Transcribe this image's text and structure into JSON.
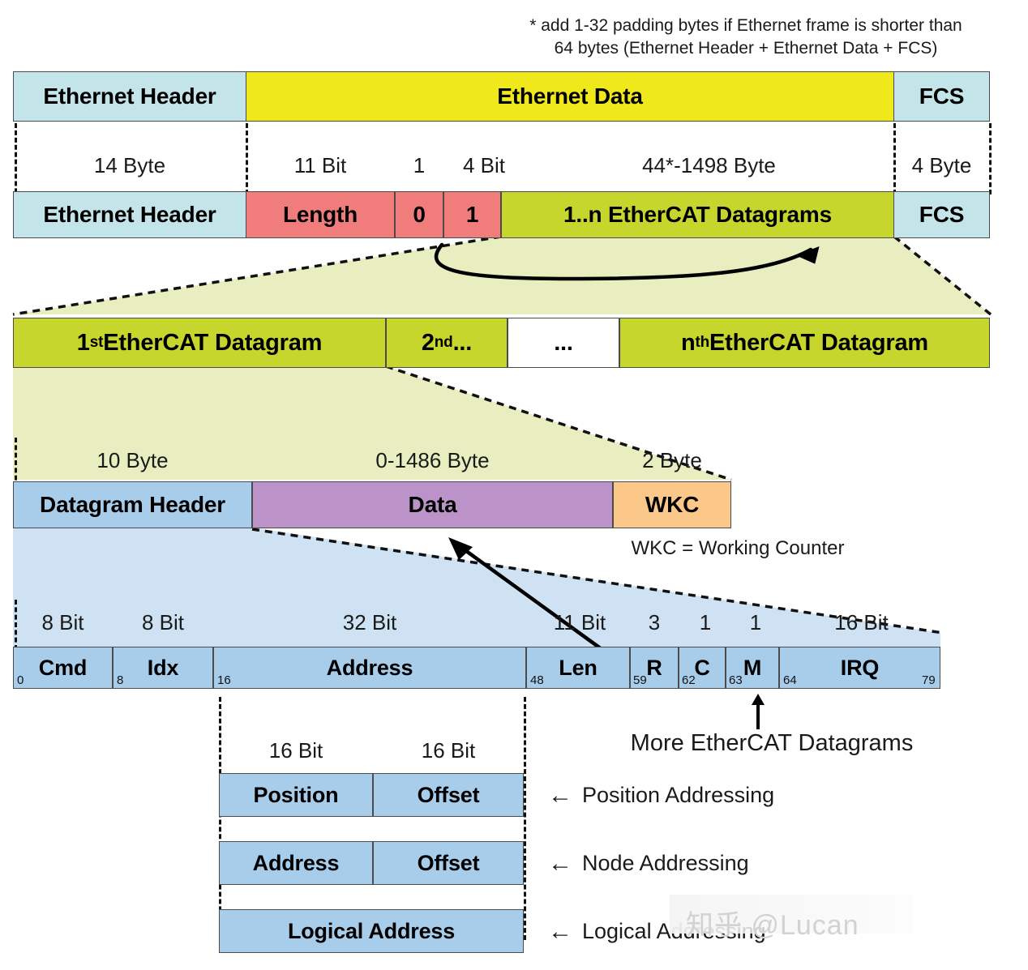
{
  "footnote": {
    "line1": "* add 1-32 padding bytes if Ethernet frame is shorter than",
    "line2": "64 bytes (Ethernet Header + Ethernet Data + FCS)"
  },
  "ethernet_frame": {
    "row_top": [
      {
        "label": "Ethernet Header",
        "color": "#c3e4e8"
      },
      {
        "label": "Ethernet Data",
        "color": "#efe81a"
      },
      {
        "label": "FCS",
        "color": "#c3e4e8"
      }
    ],
    "sizes": [
      "14 Byte",
      "11 Bit",
      "1",
      "4 Bit",
      "44*-1498 Byte",
      "4 Byte"
    ],
    "row_bottom": [
      {
        "label": "Ethernet Header",
        "color": "#c3e4e8"
      },
      {
        "label": "Length",
        "color": "#f07c7c"
      },
      {
        "label": "0",
        "color": "#f07c7c"
      },
      {
        "label": "1",
        "color": "#f07c7c"
      },
      {
        "label": "1..n EtherCAT Datagrams",
        "color": "#c6d62c"
      },
      {
        "label": "FCS",
        "color": "#c3e4e8"
      }
    ]
  },
  "datagram_list": [
    {
      "label": "1st EtherCAT Datagram",
      "sup": "st",
      "base": "1",
      "tail": " EtherCAT Datagram",
      "color": "#c6d62c"
    },
    {
      "label": "2nd...",
      "sup": "nd",
      "base": "2",
      "tail": "...",
      "color": "#c6d62c"
    },
    {
      "label": "...",
      "color": "#ffffff"
    },
    {
      "label": "nth EtherCAT Datagram",
      "sup": "th",
      "base": "n",
      "tail": " EtherCAT Datagram",
      "color": "#c6d62c"
    }
  ],
  "datagram_detail": {
    "sizes": [
      "10 Byte",
      "0-1486 Byte",
      "2 Byte"
    ],
    "cells": [
      {
        "label": "Datagram Header",
        "color": "#a7cdeb"
      },
      {
        "label": "Data",
        "color": "#bb93c9"
      },
      {
        "label": "WKC",
        "color": "#fbc88a"
      }
    ],
    "legend": "WKC = Working Counter"
  },
  "datagram_header": {
    "sizes": [
      "8 Bit",
      "8 Bit",
      "32 Bit",
      "11 Bit",
      "3",
      "1",
      "1",
      "16 Bit"
    ],
    "fields": [
      {
        "label": "Cmd",
        "start": "0"
      },
      {
        "label": "Idx",
        "start": "8"
      },
      {
        "label": "Address",
        "start": "16"
      },
      {
        "label": "Len",
        "start": "48"
      },
      {
        "label": "R",
        "start": "59"
      },
      {
        "label": "C",
        "start": "62"
      },
      {
        "label": "M",
        "start": "63"
      },
      {
        "label": "IRQ",
        "start": "64",
        "end": "79"
      }
    ],
    "more_datagrams_note": "More EtherCAT Datagrams"
  },
  "addressing": {
    "sizes": [
      "16 Bit",
      "16 Bit"
    ],
    "modes": [
      {
        "cells": [
          {
            "label": "Position"
          },
          {
            "label": "Offset"
          }
        ],
        "caption": "Position Addressing",
        "arrow": "←"
      },
      {
        "cells": [
          {
            "label": "Address"
          },
          {
            "label": "Offset"
          }
        ],
        "caption": "Node Addressing",
        "arrow": "←"
      },
      {
        "cells": [
          {
            "label": "Logical Address"
          }
        ],
        "caption": "Logical Addressing",
        "arrow": "←"
      }
    ]
  },
  "watermark": {
    "text": "知乎 @Lucan"
  },
  "colors": {
    "cyan": "#c3e4e8",
    "yellow": "#efe81a",
    "red": "#f07c7c",
    "olive": "#c6d62c",
    "blue": "#a7cdeb",
    "purple": "#bb93c9",
    "orange": "#fbc88a",
    "funnel_olive": "#e8eec0",
    "funnel_blue": "#cfe2f3",
    "outline": "#4b4b4b"
  }
}
